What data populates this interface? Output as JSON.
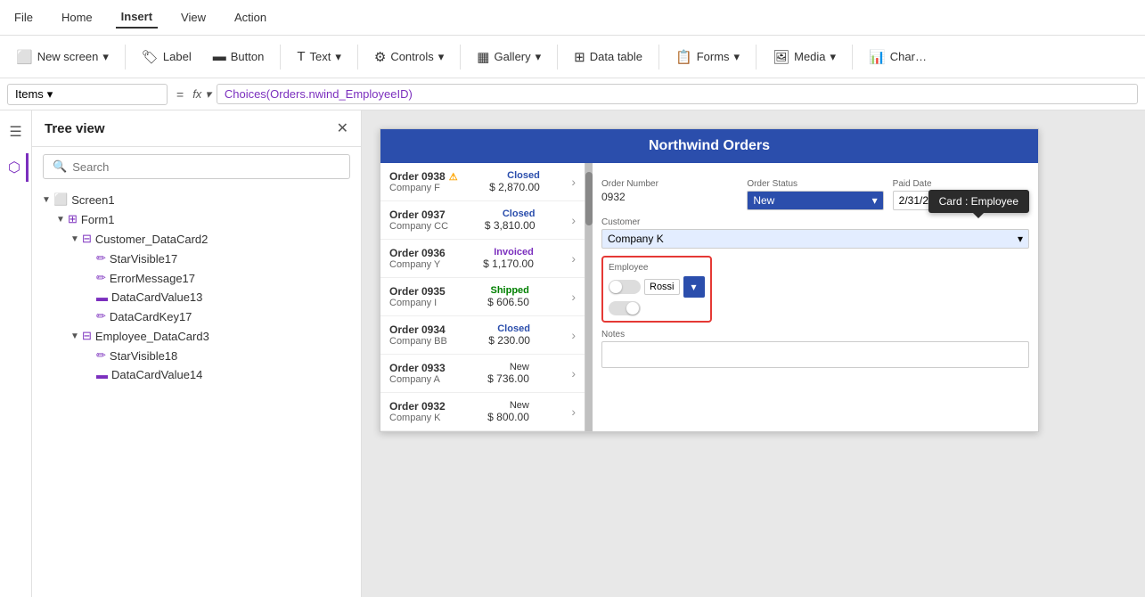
{
  "menuBar": {
    "items": [
      {
        "label": "File",
        "active": false
      },
      {
        "label": "Home",
        "active": false
      },
      {
        "label": "Insert",
        "active": true
      },
      {
        "label": "View",
        "active": false
      },
      {
        "label": "Action",
        "active": false
      }
    ]
  },
  "toolbar": {
    "buttons": [
      {
        "label": "New screen",
        "icon": "⬜",
        "hasDropdown": true
      },
      {
        "label": "Label",
        "icon": "🏷",
        "hasDropdown": false
      },
      {
        "label": "Button",
        "icon": "⬛",
        "hasDropdown": false
      },
      {
        "label": "Text",
        "icon": "T",
        "hasDropdown": true
      },
      {
        "label": "Controls",
        "icon": "⚙",
        "hasDropdown": true
      },
      {
        "label": "Gallery",
        "icon": "▦",
        "hasDropdown": true
      },
      {
        "label": "Data table",
        "icon": "⊞",
        "hasDropdown": false
      },
      {
        "label": "Forms",
        "icon": "📋",
        "hasDropdown": true
      },
      {
        "label": "Media",
        "icon": "🖼",
        "hasDropdown": true
      },
      {
        "label": "Char…",
        "icon": "📊",
        "hasDropdown": false
      }
    ]
  },
  "formulaBar": {
    "dropdown": "Items",
    "equals": "=",
    "fx": "fx",
    "formula": "Choices(Orders.nwind_EmployeeID)"
  },
  "treeView": {
    "title": "Tree view",
    "searchPlaceholder": "Search",
    "nodes": [
      {
        "id": "screen1",
        "label": "Screen1",
        "level": 0,
        "type": "screen",
        "expanded": true
      },
      {
        "id": "form1",
        "label": "Form1",
        "level": 1,
        "type": "form",
        "expanded": true
      },
      {
        "id": "customer_dc2",
        "label": "Customer_DataCard2",
        "level": 2,
        "type": "datacard",
        "expanded": true
      },
      {
        "id": "starvisible17",
        "label": "StarVisible17",
        "level": 3,
        "type": "edit"
      },
      {
        "id": "errormessage17",
        "label": "ErrorMessage17",
        "level": 3,
        "type": "edit"
      },
      {
        "id": "datacardvalue13",
        "label": "DataCardValue13",
        "level": 3,
        "type": "label"
      },
      {
        "id": "datacardkey17",
        "label": "DataCardKey17",
        "level": 3,
        "type": "edit"
      },
      {
        "id": "employee_dc3",
        "label": "Employee_DataCard3",
        "level": 2,
        "type": "datacard",
        "expanded": true
      },
      {
        "id": "starvisible18",
        "label": "StarVisible18",
        "level": 3,
        "type": "edit"
      },
      {
        "id": "datacardvalue14",
        "label": "DataCardValue14",
        "level": 3,
        "type": "label"
      }
    ]
  },
  "app": {
    "title": "Northwind Orders",
    "orders": [
      {
        "num": "Order 0938",
        "company": "Company F",
        "status": "Closed",
        "amount": "$ 2,870.00",
        "hasWarning": true
      },
      {
        "num": "Order 0937",
        "company": "Company CC",
        "status": "Closed",
        "amount": "$ 3,810.00",
        "hasWarning": false
      },
      {
        "num": "Order 0936",
        "company": "Company Y",
        "status": "Invoiced",
        "amount": "$ 1,170.00",
        "hasWarning": false
      },
      {
        "num": "Order 0935",
        "company": "Company I",
        "status": "Shipped",
        "amount": "$ 606.50",
        "hasWarning": false
      },
      {
        "num": "Order 0934",
        "company": "Company BB",
        "status": "Closed",
        "amount": "$ 230.00",
        "hasWarning": false
      },
      {
        "num": "Order 0933",
        "company": "Company A",
        "status": "New",
        "amount": "$ 736.00",
        "hasWarning": false
      },
      {
        "num": "Order 0932",
        "company": "Company K",
        "status": "New",
        "amount": "$ 800.00",
        "hasWarning": false
      }
    ],
    "detail": {
      "orderNumberLabel": "Order Number",
      "orderNumberValue": "0932",
      "orderStatusLabel": "Order Status",
      "orderStatusValue": "New",
      "paidDateLabel": "Paid Date",
      "paidDateValue": "2/31/2001",
      "customerLabel": "Customer",
      "customerValue": "Company K",
      "employeeLabel": "Employee",
      "employeeValue": "Rossi",
      "notesLabel": "Notes",
      "notesValue": ""
    },
    "tooltip": "Card : Employee"
  }
}
